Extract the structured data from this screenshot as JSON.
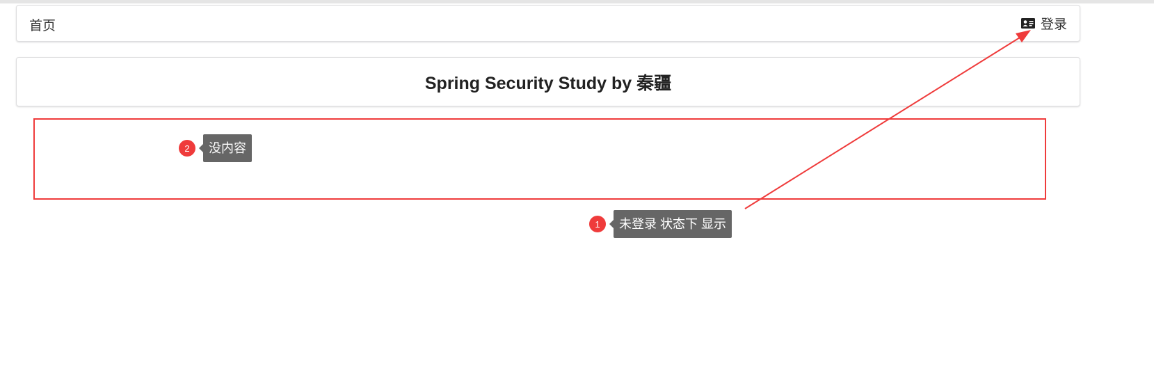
{
  "navbar": {
    "home_label": "首页",
    "login_label": "登录",
    "login_icon": "id-card-icon"
  },
  "main": {
    "title": "Spring Security Study by 秦疆"
  },
  "annotations": [
    {
      "number": "1",
      "text": "未登录 状态下 显示"
    },
    {
      "number": "2",
      "text": "没内容"
    }
  ],
  "colors": {
    "annotation_red": "#ef3b3b",
    "bubble_gray": "#666666"
  }
}
